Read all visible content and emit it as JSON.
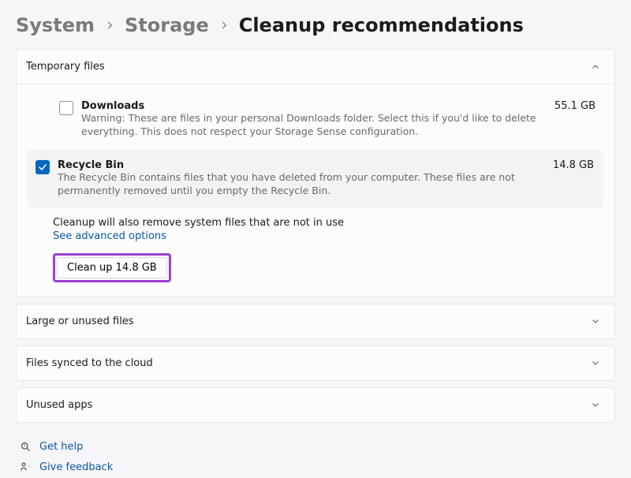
{
  "breadcrumb": {
    "root": "System",
    "mid": "Storage",
    "current": "Cleanup recommendations"
  },
  "sections": {
    "temp": {
      "title": "Temporary files",
      "items": [
        {
          "title": "Downloads",
          "desc": "Warning: These are files in your personal Downloads folder. Select this if you'd like to delete everything. This does not respect your Storage Sense configuration.",
          "size": "55.1 GB",
          "checked": false
        },
        {
          "title": "Recycle Bin",
          "desc": "The Recycle Bin contains files that you have deleted from your computer. These files are not permanently removed until you empty the Recycle Bin.",
          "size": "14.8 GB",
          "checked": true
        }
      ],
      "note": "Cleanup will also remove system files that are not in use",
      "advanced_link": "See advanced options",
      "action_label": "Clean up 14.8 GB"
    },
    "large": {
      "title": "Large or unused files"
    },
    "cloud": {
      "title": "Files synced to the cloud"
    },
    "unused": {
      "title": "Unused apps"
    }
  },
  "footer": {
    "help": "Get help",
    "feedback": "Give feedback"
  }
}
